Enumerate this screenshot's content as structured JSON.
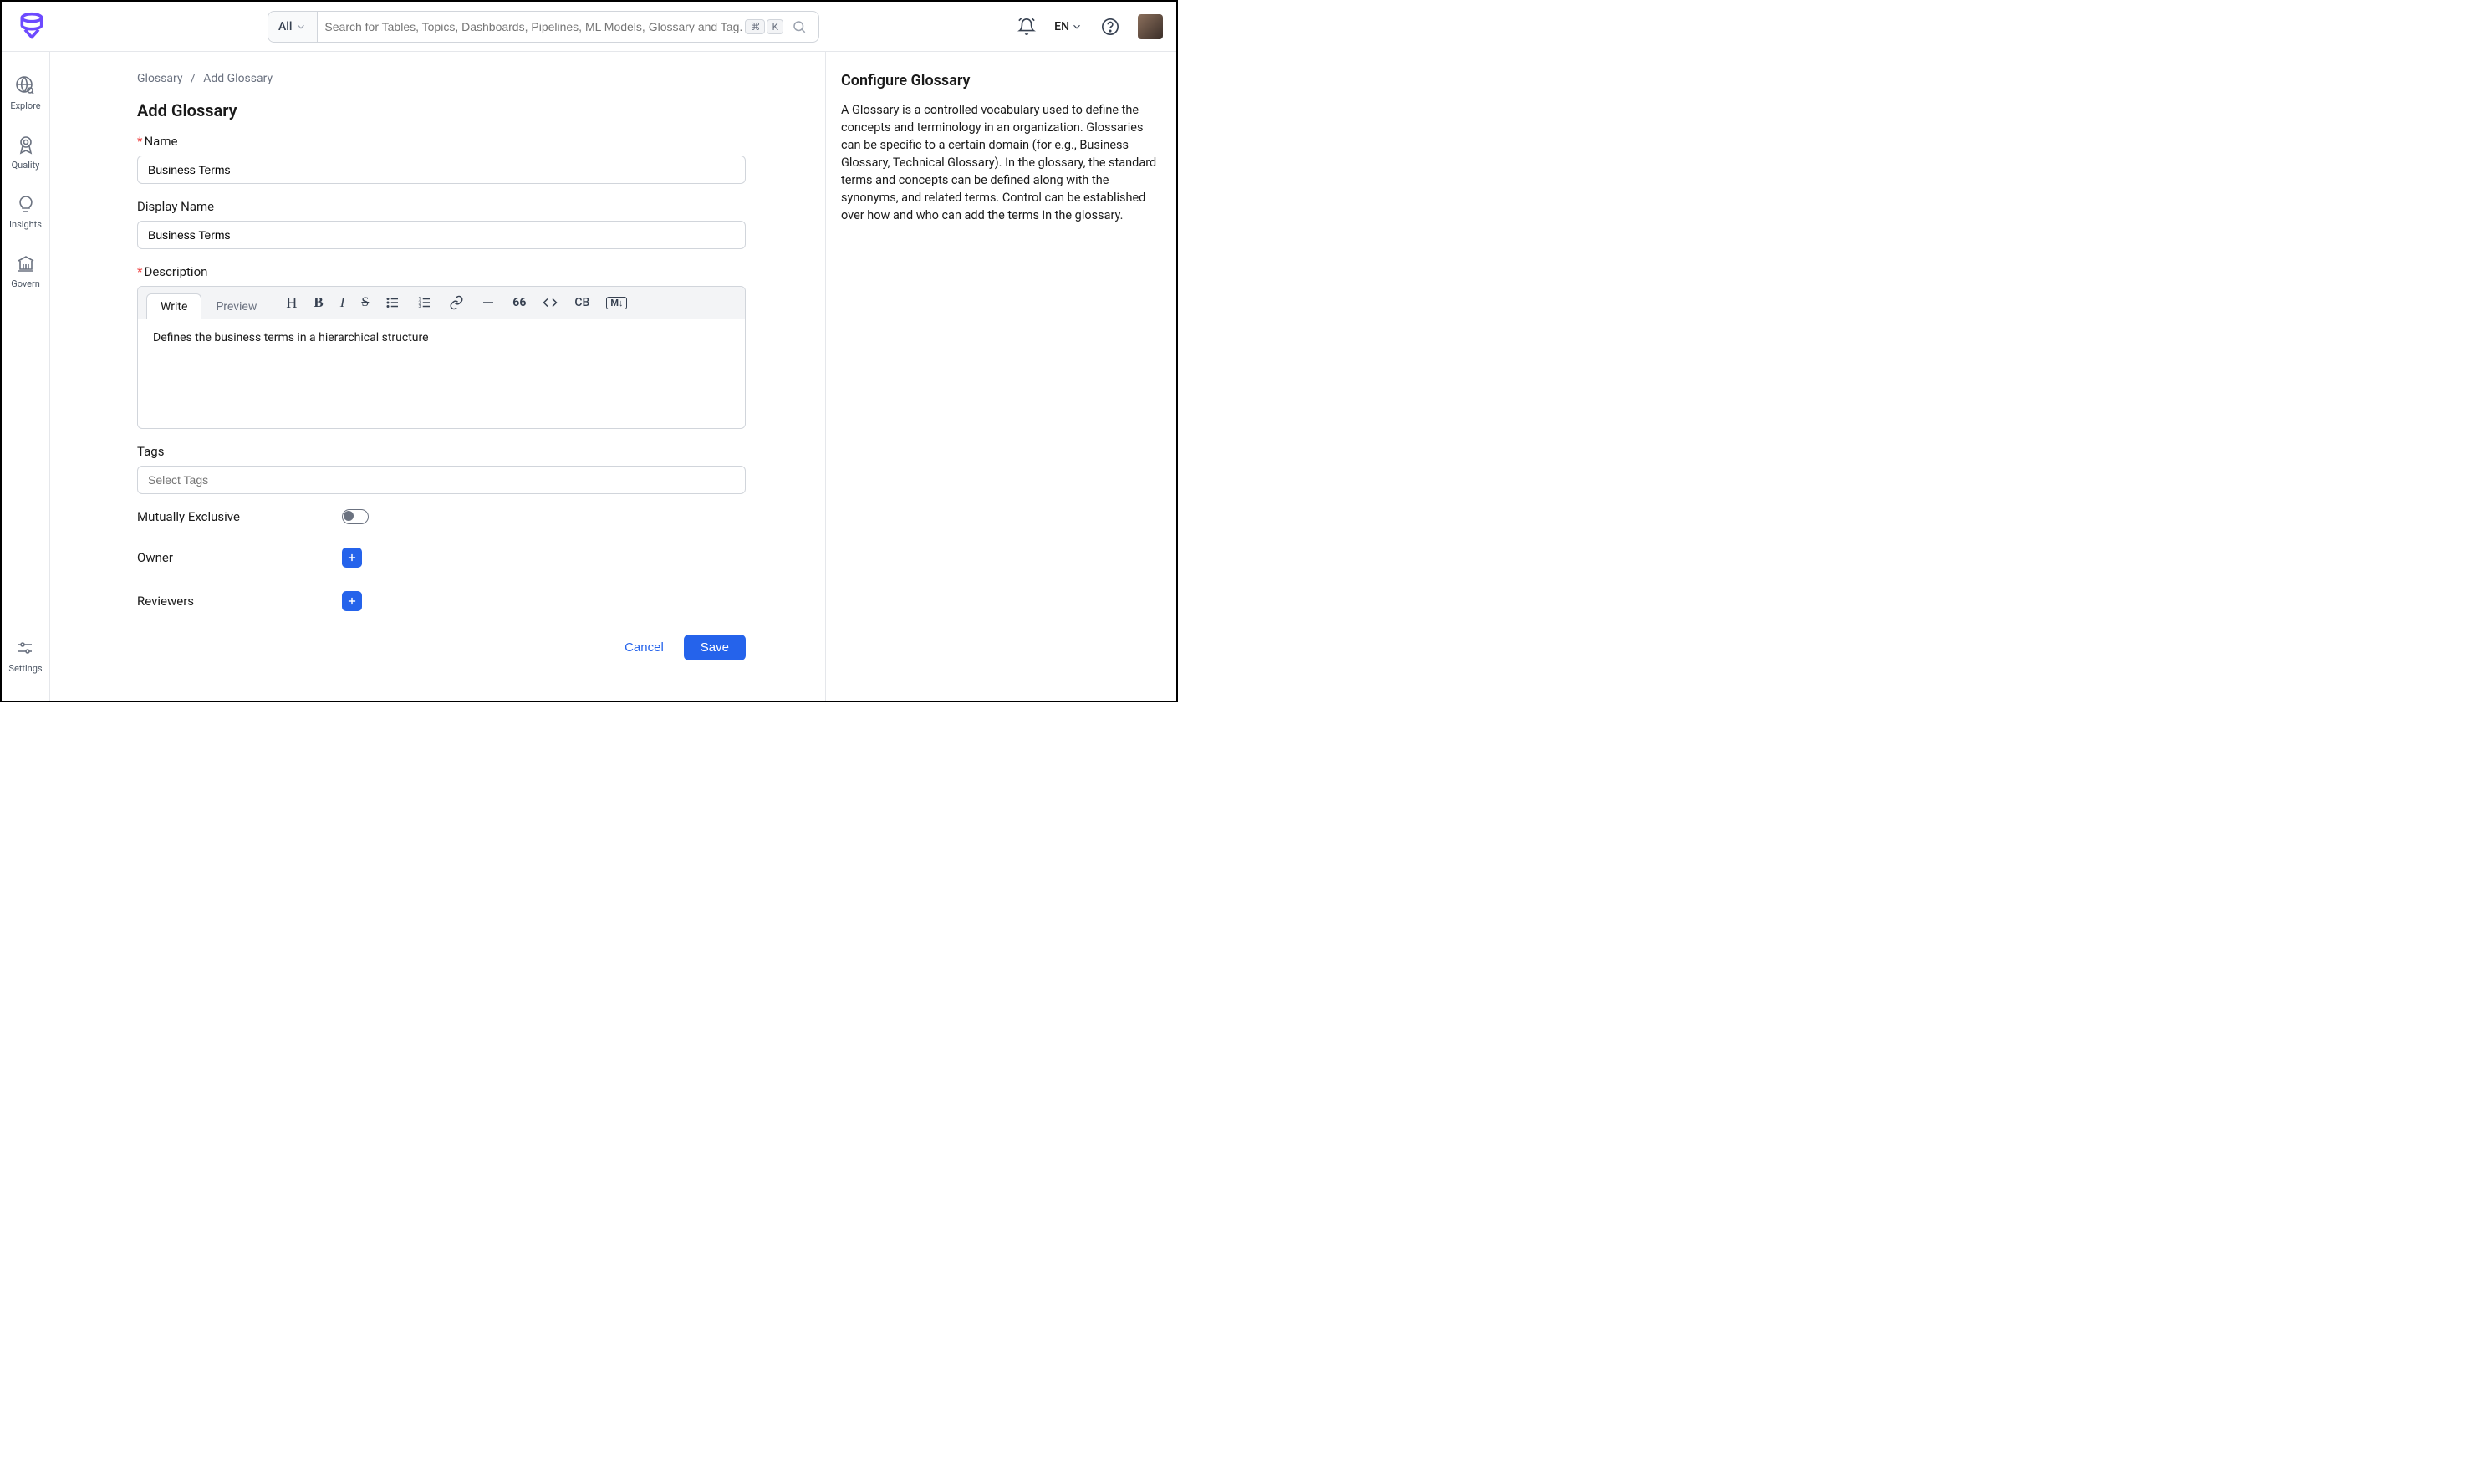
{
  "header": {
    "search_scope": "All",
    "search_placeholder": "Search for Tables, Topics, Dashboards, Pipelines, ML Models, Glossary and Tag...",
    "kbd1": "⌘",
    "kbd2": "K",
    "language": "EN"
  },
  "sidebar": {
    "items": [
      {
        "label": "Explore"
      },
      {
        "label": "Quality"
      },
      {
        "label": "Insights"
      },
      {
        "label": "Govern"
      }
    ],
    "settings_label": "Settings"
  },
  "breadcrumb": {
    "root": "Glossary",
    "sep": "/",
    "current": "Add Glossary"
  },
  "page_title": "Add Glossary",
  "form": {
    "name_label": "Name",
    "name_value": "Business Terms",
    "display_name_label": "Display Name",
    "display_name_value": "Business Terms",
    "description_label": "Description",
    "editor_tabs": {
      "write": "Write",
      "preview": "Preview"
    },
    "description_value": "Defines the business terms in a hierarchical structure",
    "tags_label": "Tags",
    "tags_placeholder": "Select Tags",
    "mutually_exclusive_label": "Mutually Exclusive",
    "owner_label": "Owner",
    "reviewers_label": "Reviewers"
  },
  "toolbar": {
    "quote": "66",
    "codeblock": "CB",
    "markdown": "M↓"
  },
  "actions": {
    "cancel": "Cancel",
    "save": "Save"
  },
  "right_panel": {
    "title": "Configure Glossary",
    "body": "A Glossary is a controlled vocabulary used to define the concepts and terminology in an organization. Glossaries can be specific to a certain domain (for e.g., Business Glossary, Technical Glossary). In the glossary, the standard terms and concepts can be defined along with the synonyms, and related terms. Control can be established over how and who can add the terms in the glossary."
  }
}
